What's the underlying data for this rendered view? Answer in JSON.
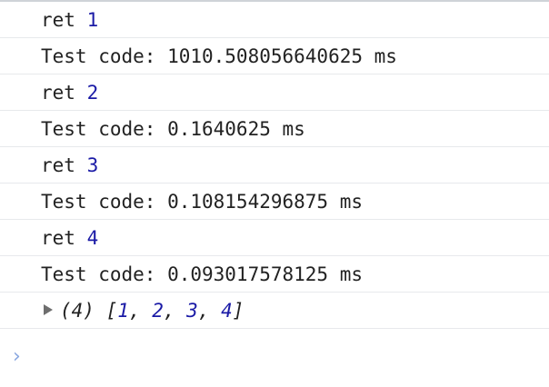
{
  "console": {
    "logs": [
      {
        "label": "ret",
        "value": "1"
      },
      {
        "text": "Test code: 1010.508056640625 ms"
      },
      {
        "label": "ret",
        "value": "2"
      },
      {
        "text": "Test code: 0.1640625 ms"
      },
      {
        "label": "ret",
        "value": "3"
      },
      {
        "text": "Test code: 0.108154296875 ms"
      },
      {
        "label": "ret",
        "value": "4"
      },
      {
        "text": "Test code: 0.093017578125 ms"
      }
    ],
    "array_result": {
      "count": "(4)",
      "open": "[",
      "values": [
        "1",
        "2",
        "3",
        "4"
      ],
      "close": "]"
    },
    "prompt_symbol": "›"
  }
}
